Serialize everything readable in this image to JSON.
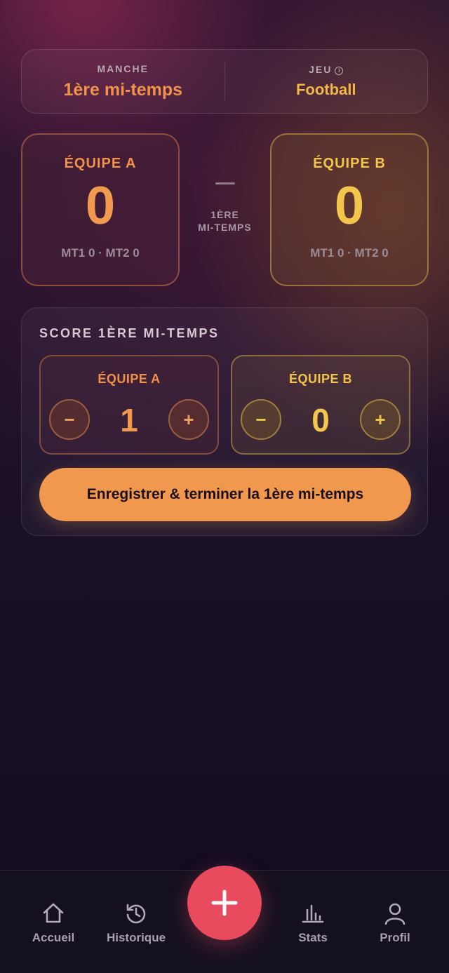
{
  "header": {
    "round_label": "MANCHE",
    "round_value": "1ère mi-temps",
    "game_label": "JEU",
    "game_value": "Football"
  },
  "scoreboard": {
    "team_a": {
      "name": "ÉQUIPE A",
      "score": "0",
      "halves": "MT1 0 · MT2 0"
    },
    "team_b": {
      "name": "ÉQUIPE B",
      "score": "0",
      "halves": "MT1 0 · MT2 0"
    },
    "separator": "–",
    "period_label": "1ÈRE\nMI-TEMPS"
  },
  "half_panel": {
    "title": "SCORE 1ÈRE MI-TEMPS",
    "team_a": {
      "name": "ÉQUIPE A",
      "value": "1",
      "minus": "−",
      "plus": "+"
    },
    "team_b": {
      "name": "ÉQUIPE B",
      "value": "0",
      "minus": "−",
      "plus": "+"
    },
    "submit_label": "Enregistrer & terminer la 1ère mi-temps"
  },
  "nav": {
    "items": [
      {
        "label": "Accueil",
        "icon": "home-icon"
      },
      {
        "label": "Historique",
        "icon": "history-icon"
      },
      {
        "label": "Stats",
        "icon": "bar-chart-icon"
      },
      {
        "label": "Profil",
        "icon": "user-icon"
      }
    ],
    "fab_icon": "plus-icon"
  },
  "colors": {
    "accent_orange": "#f0984e",
    "accent_yellow": "#f2c64c",
    "fab_red": "#e94b5e"
  }
}
